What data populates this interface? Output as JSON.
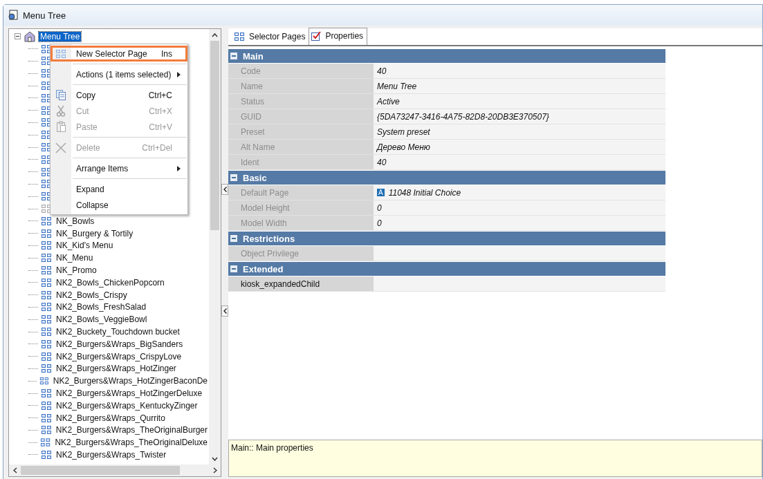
{
  "window": {
    "title": "Menu Tree"
  },
  "tree": {
    "root": {
      "label": "Menu Tree",
      "selected": true,
      "expanded": true
    },
    "children": [
      {
        "kind": "covered",
        "disabled": false
      },
      {
        "kind": "covered",
        "disabled": false
      },
      {
        "kind": "covered",
        "disabled": false
      },
      {
        "kind": "covered",
        "disabled": false
      },
      {
        "kind": "covered",
        "disabled": false
      },
      {
        "kind": "covered",
        "disabled": false
      },
      {
        "kind": "covered",
        "disabled": false
      },
      {
        "kind": "covered",
        "disabled": false
      },
      {
        "kind": "covered",
        "disabled": false
      },
      {
        "kind": "covered",
        "disabled": false
      },
      {
        "kind": "covered",
        "disabled": false
      },
      {
        "kind": "covered",
        "disabled": false
      },
      {
        "kind": "covered",
        "disabled": false
      },
      {
        "kind": "covered",
        "disabled": true
      },
      {
        "kind": "page",
        "label": "NK_Bowls",
        "disabled": false
      },
      {
        "kind": "page",
        "label": "NK_Burgery & Tortily",
        "disabled": false
      },
      {
        "kind": "page",
        "label": "NK_Kid's Menu",
        "disabled": false
      },
      {
        "kind": "page",
        "label": "NK_Menu",
        "disabled": false
      },
      {
        "kind": "page",
        "label": "NK_Promo",
        "disabled": false
      },
      {
        "kind": "page",
        "label": "NK2_Bowls_ChickenPopcorn",
        "disabled": false
      },
      {
        "kind": "page",
        "label": "NK2_Bowls_Crispy",
        "disabled": false
      },
      {
        "kind": "page",
        "label": "NK2_Bowls_FreshSalad",
        "disabled": false
      },
      {
        "kind": "page",
        "label": "NK2_Bowls_VeggieBowl",
        "disabled": false
      },
      {
        "kind": "page",
        "label": "NK2_Buckety_Touchdown bucket",
        "disabled": false
      },
      {
        "kind": "page",
        "label": "NK2_Burgers&Wraps_BigSanders",
        "disabled": false
      },
      {
        "kind": "page",
        "label": "NK2_Burgers&Wraps_CrispyLove",
        "disabled": false
      },
      {
        "kind": "page",
        "label": "NK2_Burgers&Wraps_HotZinger",
        "disabled": false
      },
      {
        "kind": "page",
        "label": "NK2_Burgers&Wraps_HotZingerBaconDe",
        "disabled": false
      },
      {
        "kind": "page",
        "label": "NK2_Burgers&Wraps_HotZingerDeluxe",
        "disabled": false
      },
      {
        "kind": "page",
        "label": "NK2_Burgers&Wraps_KentuckyZinger",
        "disabled": false
      },
      {
        "kind": "page",
        "label": "NK2_Burgers&Wraps_Qurrito",
        "disabled": false
      },
      {
        "kind": "page",
        "label": "NK2_Burgers&Wraps_TheOriginalBurger",
        "disabled": false
      },
      {
        "kind": "page",
        "label": "NK2_Burgers&Wraps_TheOriginalDeluxe",
        "disabled": false
      },
      {
        "kind": "page",
        "label": "NK2_Burgers&Wraps_Twister",
        "disabled": false
      }
    ]
  },
  "context_menu": {
    "items": [
      {
        "kind": "item",
        "label": "New Selector Page",
        "shortcut": "Ins",
        "disabled": false,
        "highlighted": true
      },
      {
        "kind": "separator"
      },
      {
        "kind": "submenu",
        "label": "Actions (1 items selected)",
        "disabled": false,
        "highlighted": false
      },
      {
        "kind": "separator"
      },
      {
        "kind": "item",
        "label": "Copy",
        "shortcut": "Ctrl+C",
        "disabled": false,
        "highlighted": false
      },
      {
        "kind": "item",
        "label": "Cut",
        "shortcut": "Ctrl+X",
        "disabled": true,
        "highlighted": false
      },
      {
        "kind": "item",
        "label": "Paste",
        "shortcut": "Ctrl+V",
        "disabled": true,
        "highlighted": false
      },
      {
        "kind": "separator"
      },
      {
        "kind": "item",
        "label": "Delete",
        "shortcut": "Ctrl+Del",
        "disabled": true,
        "highlighted": false
      },
      {
        "kind": "separator"
      },
      {
        "kind": "submenu",
        "label": "Arrange Items",
        "disabled": false,
        "highlighted": false
      },
      {
        "kind": "separator"
      },
      {
        "kind": "item",
        "label": "Expand",
        "disabled": false,
        "highlighted": false
      },
      {
        "kind": "item",
        "label": "Collapse",
        "disabled": false,
        "highlighted": false
      }
    ]
  },
  "tabs": [
    {
      "label": "Selector Pages",
      "selected": false
    },
    {
      "label": "Properties",
      "selected": true
    }
  ],
  "properties": [
    {
      "section": "Main",
      "expanded": true,
      "rows": [
        {
          "name": "Code",
          "value": "40",
          "disabled": true
        },
        {
          "name": "Name",
          "value": "Menu Tree",
          "disabled": true
        },
        {
          "name": "Status",
          "value": "Active",
          "disabled": true
        },
        {
          "name": "GUID",
          "value": "{5DA73247-3416-4A75-82D8-20DB3E370507}",
          "disabled": true
        },
        {
          "name": "Preset",
          "value": "System preset",
          "disabled": true
        },
        {
          "name": "Alt Name",
          "value": "Дерево Меню",
          "disabled": true
        },
        {
          "name": "Ident",
          "value": "40",
          "disabled": true
        }
      ]
    },
    {
      "section": "Basic",
      "expanded": true,
      "rows": [
        {
          "name": "Default Page",
          "badge": "A",
          "value": "11048 Initial Choice",
          "disabled": true
        },
        {
          "name": "Model Height",
          "value": "0",
          "disabled": true
        },
        {
          "name": "Model Width",
          "value": "0",
          "disabled": true
        }
      ]
    },
    {
      "section": "Restrictions",
      "expanded": true,
      "rows": [
        {
          "name": "Object Privilege",
          "disabled": true
        }
      ]
    },
    {
      "section": "Extended",
      "expanded": true,
      "rows": [
        {
          "name": "kiosk_expandedChild",
          "disabled": false
        }
      ]
    }
  ],
  "description": "Main:: Main properties"
}
